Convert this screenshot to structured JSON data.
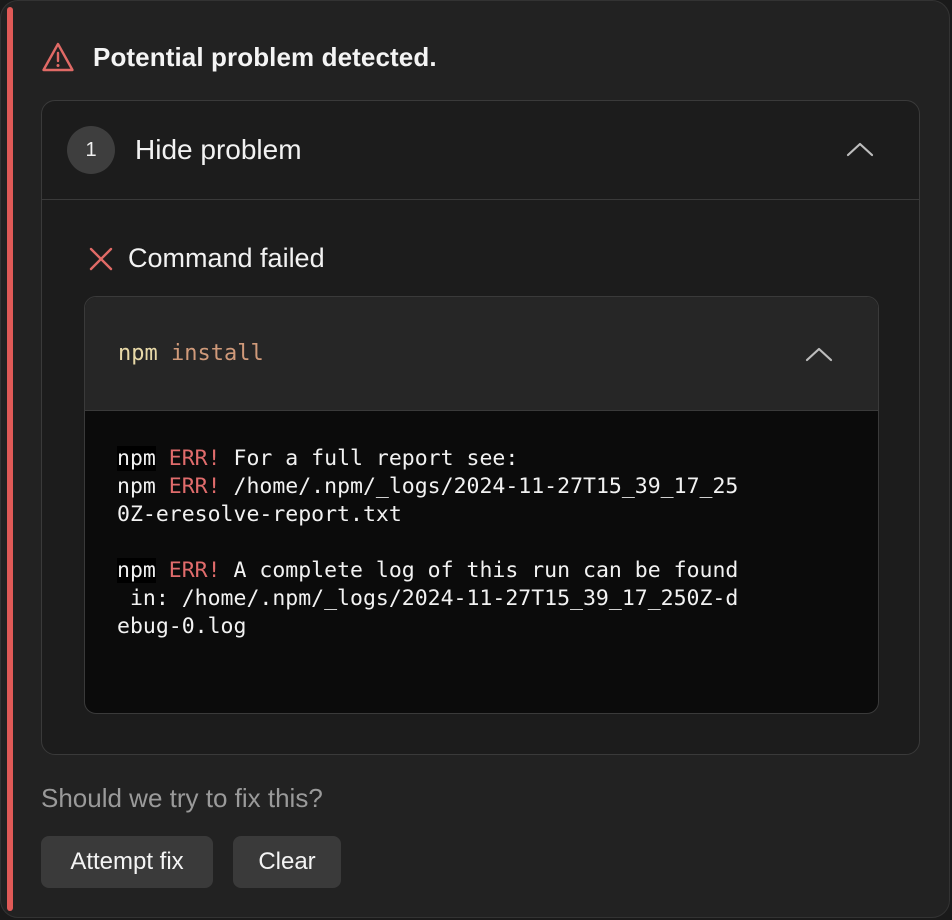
{
  "header": {
    "title": "Potential problem detected.",
    "icon": "warning-triangle-icon",
    "accent_color": "#e05a57"
  },
  "problem": {
    "step_number": "1",
    "toggle_label": "Hide problem",
    "toggle_icon": "chevron-up-icon"
  },
  "command": {
    "status": "Command failed",
    "status_icon": "x-icon",
    "program": "npm",
    "argument": "install",
    "toggle_icon": "chevron-up-icon"
  },
  "output": {
    "prefix": "npm",
    "err_tag": "ERR!",
    "lines": [
      " For a full report see:",
      " /home/.npm/_logs/2024-11-27T15_39_17_25\n0Z-eresolve-report.txt",
      " A complete log of this run can be found\n in: /home/.npm/_logs/2024-11-27T15_39_17_250Z-d\nebug-0.log"
    ]
  },
  "footer": {
    "question": "Should we try to fix this?",
    "attempt_fix_label": "Attempt fix",
    "clear_label": "Clear"
  }
}
